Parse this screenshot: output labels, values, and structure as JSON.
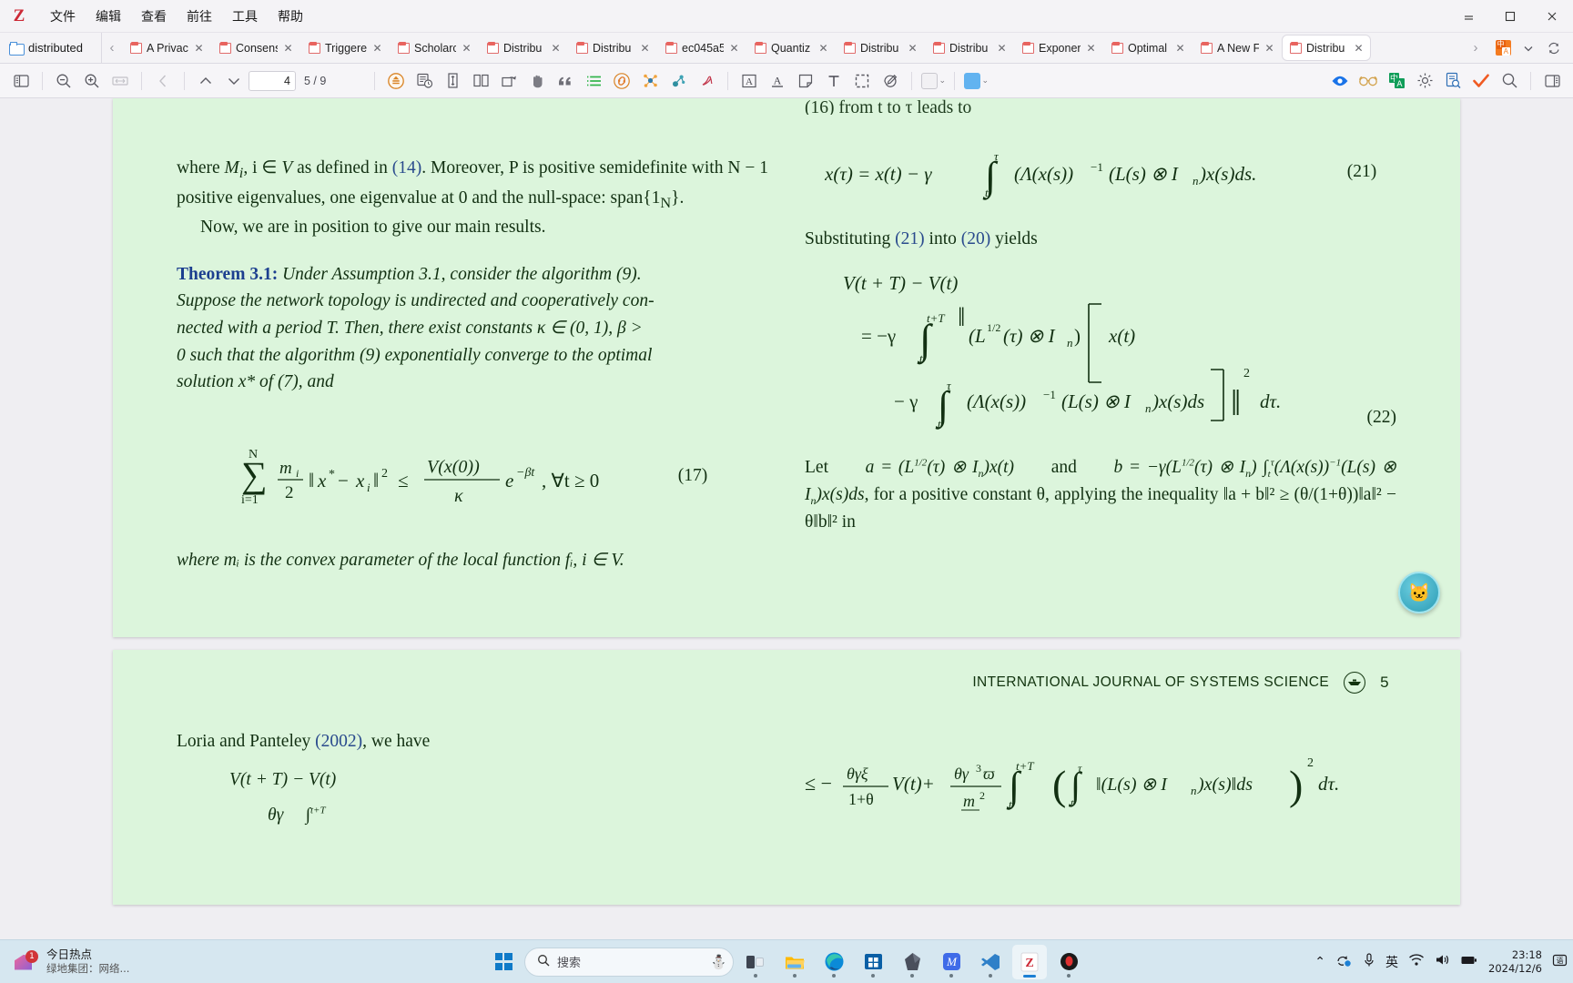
{
  "window": {
    "app_logo": "Z",
    "menus": [
      "文件",
      "编辑",
      "查看",
      "前往",
      "工具",
      "帮助"
    ],
    "controls": {
      "minimize": "⚊",
      "maximize": "□",
      "close": "✕"
    }
  },
  "tabbar": {
    "library_tab": {
      "label": "distributed",
      "icon": "folder-icon"
    },
    "scroll_left": "‹",
    "scroll_right": "›",
    "tabs": [
      {
        "label": "A Privac",
        "close": "✕",
        "active": false
      },
      {
        "label": "Consens",
        "close": "✕",
        "active": false
      },
      {
        "label": "Triggere",
        "close": "✕",
        "active": false
      },
      {
        "label": "Scholarc",
        "close": "✕",
        "active": false
      },
      {
        "label": "Distribu",
        "close": "✕",
        "active": false
      },
      {
        "label": "Distribu",
        "close": "✕",
        "active": false
      },
      {
        "label": "ec045a5",
        "close": "✕",
        "active": false
      },
      {
        "label": "Quantiz",
        "close": "✕",
        "active": false
      },
      {
        "label": "Distribu",
        "close": "✕",
        "active": false
      },
      {
        "label": "Distribu",
        "close": "✕",
        "active": false
      },
      {
        "label": "Exponer",
        "close": "✕",
        "active": false
      },
      {
        "label": "Optimal",
        "close": "✕",
        "active": false
      },
      {
        "label": "A New F",
        "close": "✕",
        "active": false
      },
      {
        "label": "Distribu",
        "close": "✕",
        "active": true
      }
    ],
    "right_icons": [
      "translate-icon",
      "chevron-down-icon",
      "sync-icon"
    ]
  },
  "toolbar": {
    "sidebar_toggle": "sidebar-toggle-icon",
    "zoom_out": "zoom-out-icon",
    "zoom_in": "zoom-in-icon",
    "zoom_reset": "zoom-fit-width-icon",
    "back": "navigate-back-icon",
    "prev_page": "previous-page-icon",
    "next_page": "next-page-icon",
    "page_input_value": "4",
    "page_label": "5 / 9",
    "middle_icons": [
      "zotero-translate-icon",
      "read-aloud-icon",
      "page-fit-icon",
      "two-page-icon",
      "rotate-icon",
      "hand-tool-icon",
      "quote-icon",
      "list-icon",
      "link-icon",
      "network-graph-icon",
      "connected-papers-icon",
      "adobe-icon"
    ],
    "annotation_icons": [
      "highlight-text-icon",
      "underline-text-icon",
      "sticky-note-icon",
      "add-text-icon",
      "select-area-icon",
      "draw-icon"
    ],
    "color_picker": {
      "swatch": "none",
      "caret": "⌄"
    },
    "folder_color": {
      "swatch_hex": "#62b3f0",
      "caret": "⌄"
    },
    "right_icons": [
      "eye-icon",
      "glasses-icon",
      "translate-green-icon",
      "gear-icon",
      "document-search-icon",
      "checkmark-icon",
      "search-icon",
      "right-panel-icon"
    ]
  },
  "document": {
    "page1": {
      "left_column": {
        "para1_prefix": "where ",
        "para1_math1": "M",
        "para1_sub1": "i",
        "para1_mid": ", i ∈ ",
        "para1_cal": "V",
        "para1_text2": " as defined in ",
        "para1_ref1": "(14)",
        "para1_text3": ". Moreover, P is positive semidefinite with N − 1 positive eigenvalues, one eigenvalue at 0 and the null-space: span{1",
        "para1_sub2": "N",
        "para1_end": "}.",
        "para2": "Now, we are in position to give our main results.",
        "theorem_label": "Theorem 3.1:",
        "theorem_line1": "Under Assumption 3.1, consider the algorithm (9).",
        "theorem_line2": "Suppose the network topology is undirected and cooperatively con-",
        "theorem_line3": "nected with a period T. Then, there exist constants κ ∈ (0, 1), β >",
        "theorem_line4": "0 such that the algorithm (9) exponentially converge to the optimal",
        "theorem_line5": "solution x* of (7), and",
        "equation17_number": "(17)",
        "closing_line": "where mᵢ is the convex parameter of the local function fᵢ, i ∈ V."
      },
      "right_column": {
        "cut_line_top": "(16) from t to τ leads to",
        "equation21_number": "(21)",
        "substituting_text_pre": "Substituting ",
        "substituting_ref1": "(21)",
        "substituting_mid": " into ",
        "substituting_ref2": "(20)",
        "substituting_post": " yields",
        "equation22_number": "(22)",
        "let_line1": "Let",
        "let_line2": "and",
        "para_tail": ", for a positive constant θ, applying the inequality ‖a + b‖² ≥ (θ/(1+θ))‖a‖² − θ‖b‖² in"
      }
    },
    "page2": {
      "journal_header": "INTERNATIONAL JOURNAL OF SYSTEMS SCIENCE",
      "journal_logo": "journal-logo-icon",
      "page_number": "5",
      "left_column": {
        "citation_pre": "Loria and Panteley ",
        "citation_ref": "(2002)",
        "citation_post": ", we have",
        "eq_line": "V(t + T) − V(t)"
      }
    }
  },
  "floating_widget": {
    "name": "assistant-avatar",
    "glyph": "🐱"
  },
  "taskbar": {
    "news": {
      "title": "今日热点",
      "subtitle": "绿地集团：网络...",
      "badge": "1"
    },
    "start_button": "windows-start-icon",
    "search": {
      "placeholder": "搜索",
      "icon": "search-icon",
      "decoration": "snowman-icon"
    },
    "apps": [
      {
        "name": "task-view",
        "active": false
      },
      {
        "name": "file-explorer",
        "active": false
      },
      {
        "name": "microsoft-edge",
        "active": false
      },
      {
        "name": "microsoft-store",
        "active": false
      },
      {
        "name": "obsidian",
        "active": false
      },
      {
        "name": "app-m",
        "active": false
      },
      {
        "name": "visual-studio-code",
        "active": false
      },
      {
        "name": "zotero",
        "active": true
      },
      {
        "name": "app-red",
        "active": false
      }
    ],
    "tray": {
      "chevron": "⌃",
      "icons": [
        "onedrive-sync-icon",
        "microphone-icon",
        "ime-english-icon",
        "wifi-icon",
        "volume-icon",
        "battery-icon"
      ],
      "ime_label": "英",
      "time": "23:18",
      "date": "2024/12/6",
      "notification": "notification-icon"
    }
  }
}
